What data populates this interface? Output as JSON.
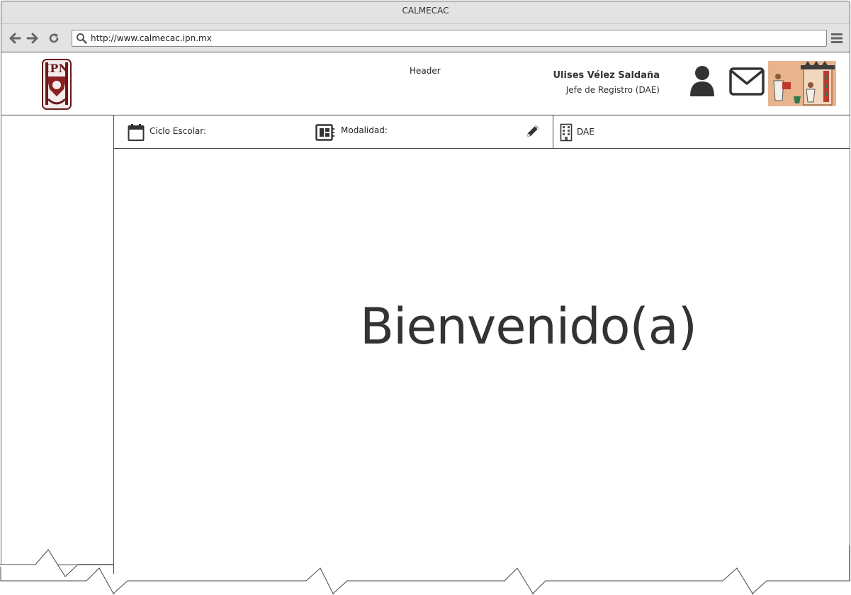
{
  "browser": {
    "window_title": "CALMECAC",
    "url": "http://www.calmecac.ipn.mx",
    "icons": [
      "back-arrow-icon",
      "forward-arrow-icon",
      "reload-icon",
      "search-icon",
      "hamburger-menu-icon"
    ]
  },
  "header": {
    "label": "Header",
    "user_name": "Ulises Vélez Saldaña",
    "user_role": "Jefe de Registro (DAE)",
    "logo_letters": "IPN",
    "icons": [
      "ipn-logo",
      "user-icon",
      "mail-icon",
      "codex-image"
    ]
  },
  "infobar": {
    "ciclo_label": "Ciclo Escolar:",
    "modalidad_label": "Modalidad:",
    "dependencia_label": "DAE",
    "icons": [
      "calendar-icon",
      "modality-icon",
      "edit-pencil-icon",
      "building-icon"
    ]
  },
  "main": {
    "welcome_text": "Bienvenido(a)"
  },
  "colors": {
    "chrome": "#e3e3e3",
    "border": "#444444",
    "text": "#333333",
    "logo": "#6b1a1a"
  }
}
